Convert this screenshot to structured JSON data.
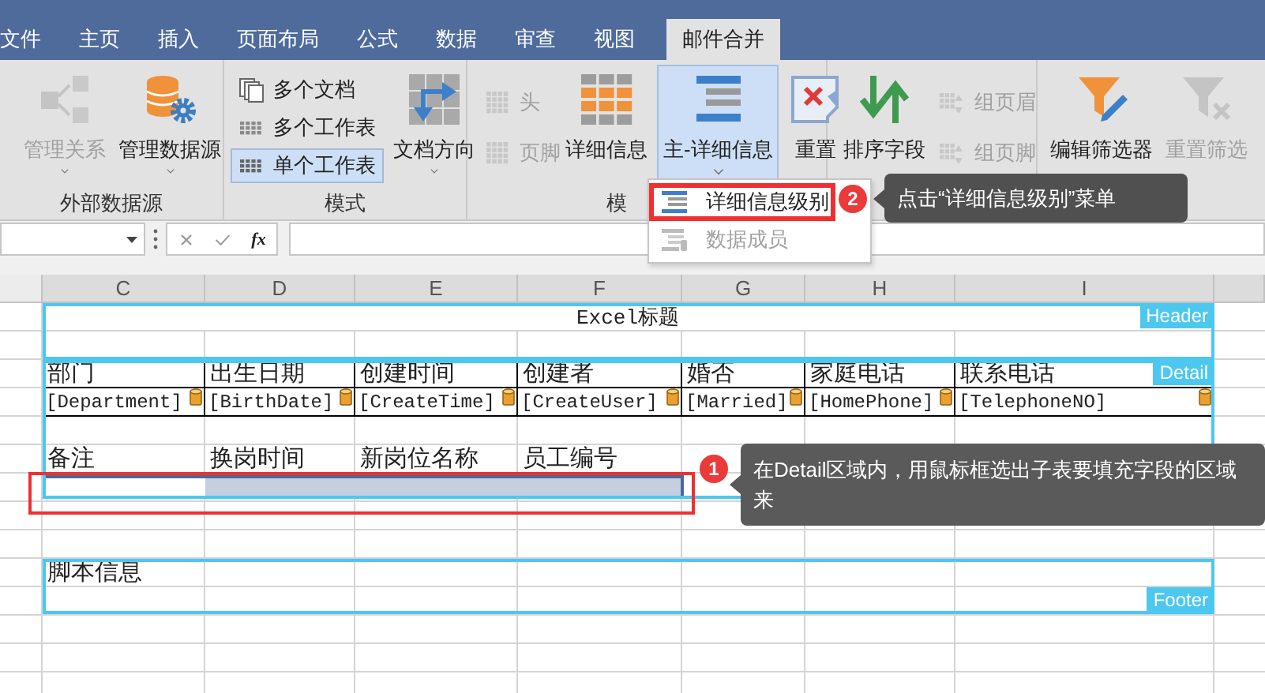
{
  "tabs": [
    {
      "label": "文件",
      "selected": false
    },
    {
      "label": "主页",
      "selected": false
    },
    {
      "label": "插入",
      "selected": false
    },
    {
      "label": "页面布局",
      "selected": false
    },
    {
      "label": "公式",
      "selected": false
    },
    {
      "label": "数据",
      "selected": false
    },
    {
      "label": "审查",
      "selected": false
    },
    {
      "label": "视图",
      "selected": false
    },
    {
      "label": "邮件合并",
      "selected": true
    }
  ],
  "ribbon": {
    "data_source": {
      "label": "外部数据源",
      "buttons": [
        {
          "label": "管理关系",
          "disabled": true
        },
        {
          "label": "管理数据源",
          "disabled": false
        }
      ]
    },
    "mode": {
      "label": "模式",
      "options": [
        {
          "label": "多个文档",
          "selected": false
        },
        {
          "label": "多个工作表",
          "selected": false
        },
        {
          "label": "单个工作表",
          "selected": true
        }
      ],
      "button": {
        "label": "文档方向"
      }
    },
    "template": {
      "label": "模",
      "small": [
        {
          "label": "头",
          "disabled": true
        },
        {
          "label": "页脚",
          "disabled": true
        }
      ],
      "buttons": [
        {
          "label": "详细信息",
          "active": false
        },
        {
          "label": "主-详细信息",
          "active": true
        },
        {
          "label": "重置",
          "active": false
        }
      ]
    },
    "sort": {
      "button": {
        "label": "排序字段"
      },
      "small": [
        {
          "label": "组页眉",
          "disabled": true
        },
        {
          "label": "组页脚",
          "disabled": true
        }
      ]
    },
    "filter": {
      "buttons": [
        {
          "label": "编辑筛选器",
          "disabled": false
        },
        {
          "label": "重置筛选",
          "disabled": true
        }
      ]
    }
  },
  "menu": {
    "items": [
      {
        "label": "详细信息级别",
        "disabled": false,
        "highlighted": true
      },
      {
        "label": "数据成员",
        "disabled": true,
        "highlighted": false
      }
    ]
  },
  "formula_bar": {
    "function_label": "fx"
  },
  "sheet": {
    "columns": [
      "C",
      "D",
      "E",
      "F",
      "G",
      "H",
      "I"
    ],
    "title": "Excel标题",
    "regions": [
      {
        "label": "Header"
      },
      {
        "label": "Detail"
      },
      {
        "label": "Footer"
      }
    ],
    "captions": [
      "部门",
      "出生日期",
      "创建时间",
      "创建者",
      "婚否",
      "家庭电话",
      "联系电话"
    ],
    "fields": [
      "[Department]",
      "[BirthDate]",
      "[CreateTime]",
      "[CreateUser]",
      "[Married]",
      "[HomePhone]",
      "[TelephoneNO]"
    ],
    "sub_captions": [
      "备注",
      "换岗时间",
      "新岗位名称",
      "员工编号"
    ],
    "footer_text": "脚本信息",
    "range_selected": true
  },
  "callouts": [
    {
      "number": "2",
      "text": "点击“详细信息级别”菜单"
    },
    {
      "number": "1",
      "text": "在Detail区域内，用鼠标框选出子表要填充字段的区域来"
    }
  ]
}
